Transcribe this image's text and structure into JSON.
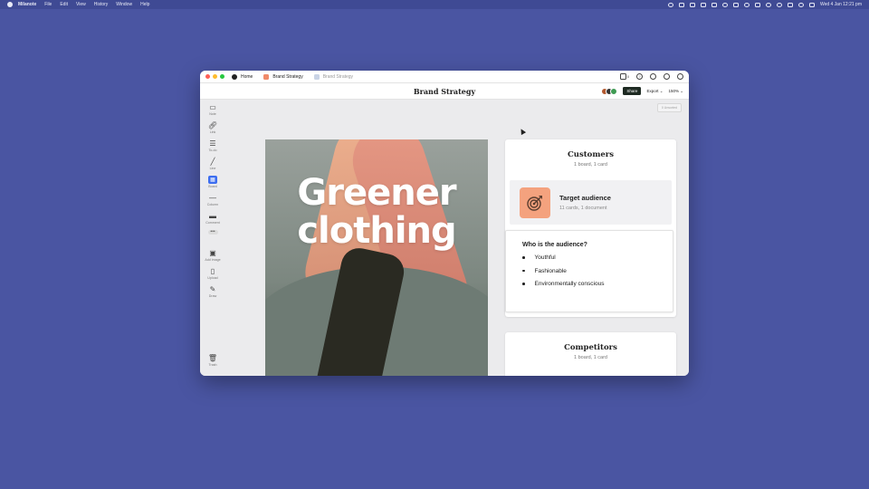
{
  "menubar": {
    "app_name": "Milanote",
    "items": [
      "File",
      "Edit",
      "View",
      "History",
      "Window",
      "Help"
    ],
    "clock": "Wed 4 Jan  12:21 pm"
  },
  "tabs": [
    {
      "label": "Home"
    },
    {
      "label": "Brand Strategy"
    },
    {
      "label": "Brand Strategy"
    }
  ],
  "header": {
    "phone_count": "0",
    "title": "Brand Strategy",
    "share_label": "Share",
    "export_label": "Export ⌄",
    "zoom_label": "150% ⌄"
  },
  "toolbar": {
    "note": "Note",
    "link": "Link",
    "todo": "To-do",
    "line": "Line",
    "board": "Board",
    "column": "Column",
    "comment": "Comment",
    "more": "•••",
    "add_image": "Add image",
    "upload": "Upload",
    "draw": "Draw",
    "trash": "Trash"
  },
  "unsorted_label": "0 Unsorted",
  "hero": {
    "line1": "Greener",
    "line2": "clothing"
  },
  "customers": {
    "title": "Customers",
    "meta": "1 board, 1 card",
    "target": {
      "name": "Target audience",
      "meta": "11 cards, 1 document"
    },
    "audience": {
      "title": "Who is the audience?",
      "items": [
        "Youthful",
        "Fashionable",
        "Environmentally conscious"
      ]
    }
  },
  "competitors": {
    "title": "Competitors",
    "meta": "1 board, 1 card"
  },
  "colors": {
    "desktop": "#4a55a2",
    "board_icon": "#3d6ef0",
    "target_icon": "#f4a27e",
    "share": "#1e2a22"
  }
}
